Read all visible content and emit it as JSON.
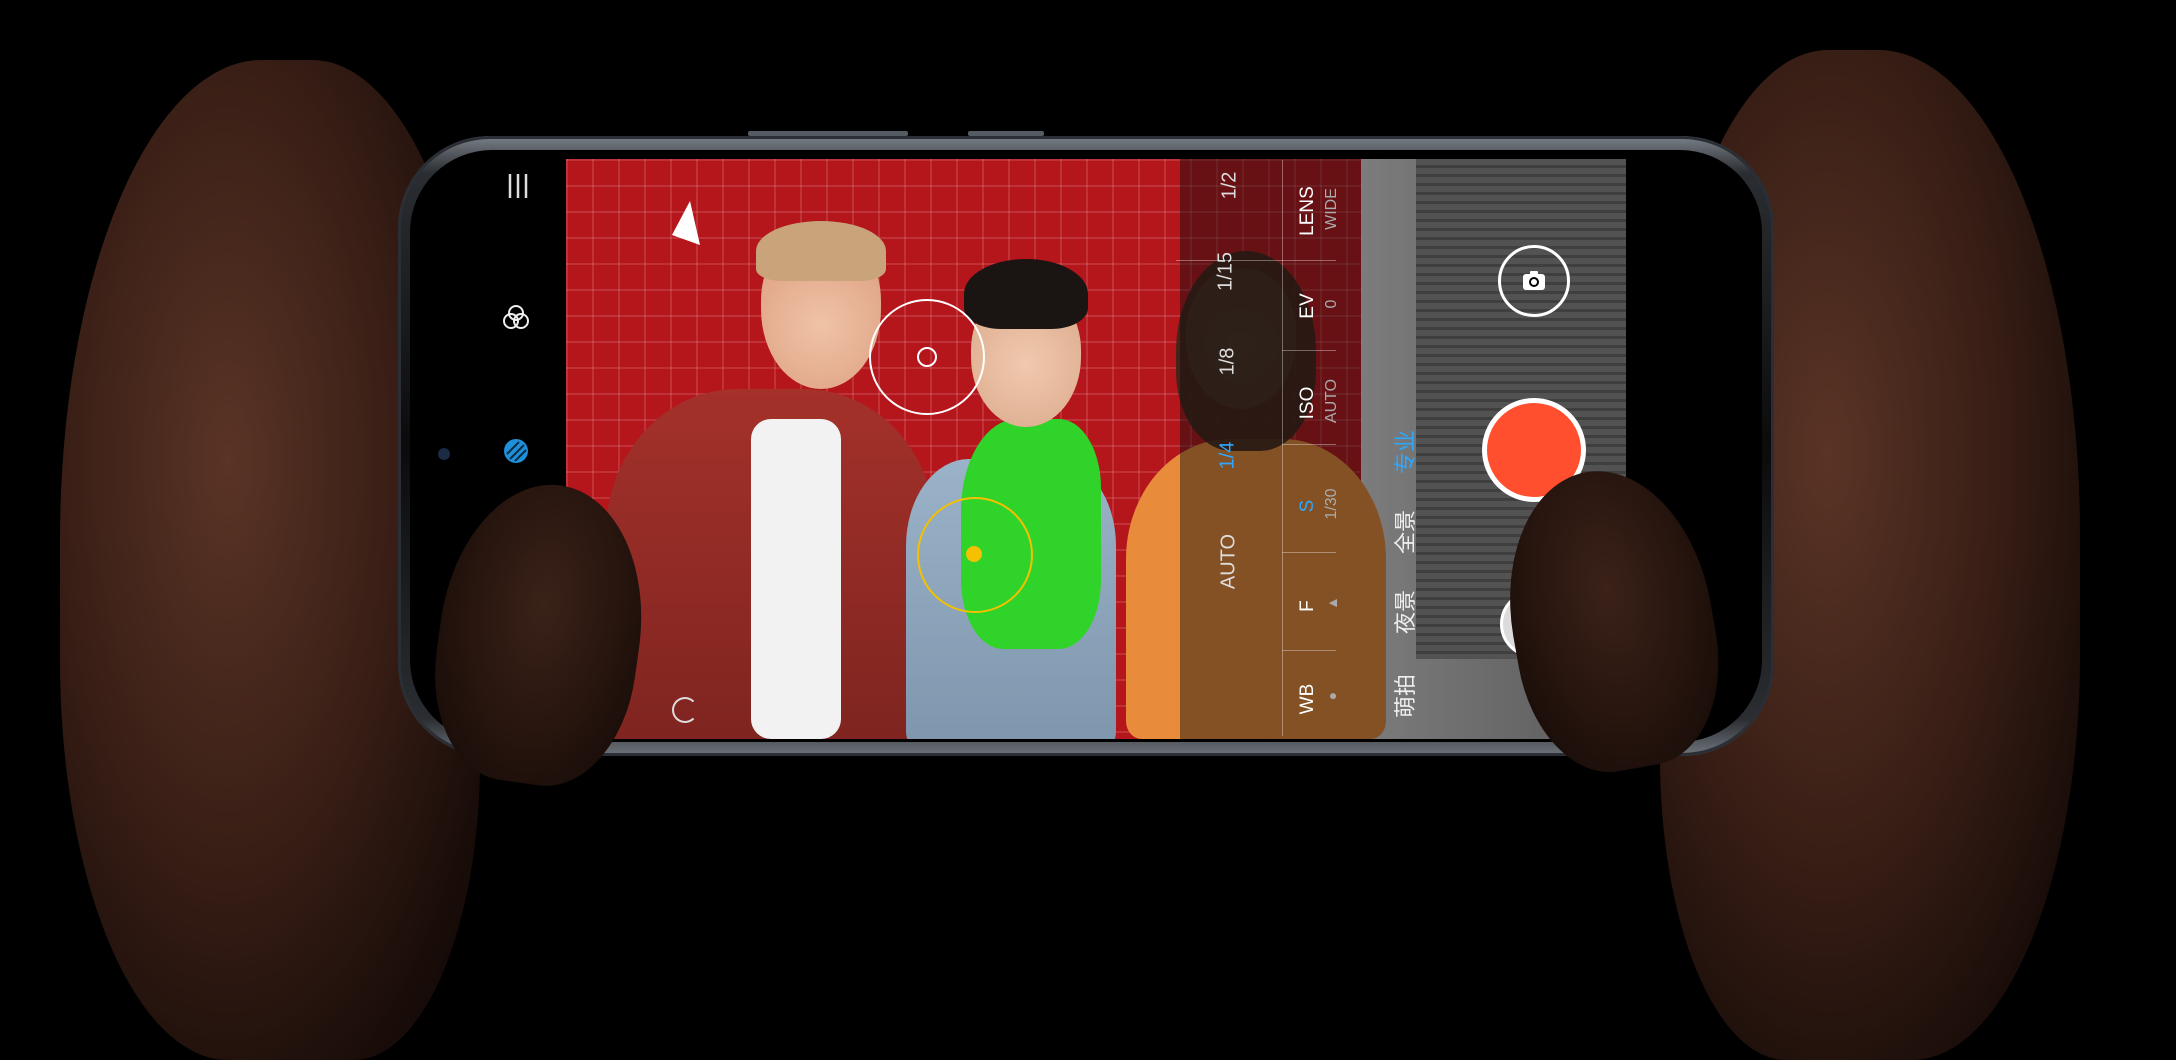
{
  "camera": {
    "left_rail": {
      "menu_icon": "menu-icon",
      "filters_icon": "filters-icon",
      "beauty_icon": "beauty-icon"
    },
    "pro_panel": {
      "lens": {
        "label": "LENS",
        "value": "WIDE"
      },
      "ev": {
        "label": "EV",
        "value": "0"
      },
      "iso": {
        "label": "ISO",
        "value": "AUTO"
      },
      "s": {
        "label": "S",
        "value": "1/30"
      },
      "f": {
        "label": "F",
        "value": "▲"
      },
      "wb": {
        "label": "WB",
        "value": "●"
      },
      "shutter_scale": [
        "1/2",
        "1/15",
        "1/8",
        "1/4",
        "AUTO"
      ],
      "selected_shutter": "1/4"
    },
    "modes": [
      "萌拍",
      "夜景",
      "全景",
      "专业"
    ],
    "active_mode": "专业",
    "accent_color": "#2ea7ff",
    "shutter_color": "#ff4f2e",
    "focus_color": "#f5c000"
  }
}
